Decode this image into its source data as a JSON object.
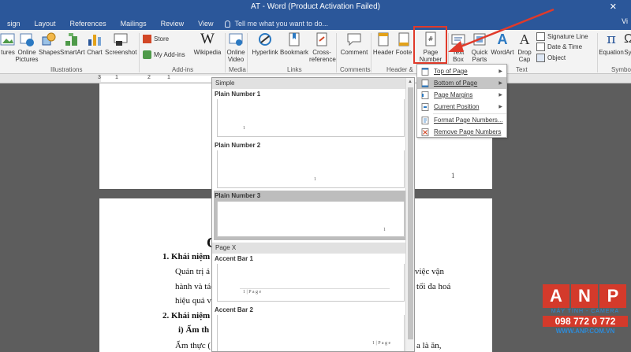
{
  "window": {
    "title": "AT - Word (Product Activation Failed)",
    "close_glyph": "✕"
  },
  "tabs": [
    "sign",
    "Layout",
    "References",
    "Mailings",
    "Review",
    "View"
  ],
  "tell_me": "Tell me what you want to do...",
  "tab_right": "Vi",
  "ribbon": {
    "buttons": {
      "pictures": "tures",
      "online_pictures": "Online Pictures",
      "shapes": "Shapes",
      "smartart": "SmartArt",
      "chart": "Chart",
      "screenshot": "Screenshot",
      "store": "Store",
      "my_addins": "My Add-ins",
      "wikipedia": "Wikipedia",
      "online_video": "Online Video",
      "hyperlink": "Hyperlink",
      "bookmark": "Bookmark",
      "cross_reference": "Cross-reference",
      "comment": "Comment",
      "header": "Header",
      "footer": "Foote",
      "page_number": "Page Number",
      "text_box": "Text Box",
      "quick_parts": "Quick Parts",
      "wordart": "WordArt",
      "drop_cap": "Drop Cap",
      "signature_line": "Signature Line",
      "date_time": "Date & Time",
      "object": "Object",
      "equation": "Equation",
      "symbol": "Sy"
    },
    "groups": {
      "illustrations": "Illustrations",
      "addins": "Add-ins",
      "media": "Media",
      "links": "Links",
      "comments": "Comments",
      "header_footer": "Header &",
      "text": "Text",
      "symbols": "Symbo"
    }
  },
  "ruler": {
    "marks": [
      "3",
      "1",
      "2",
      "1"
    ]
  },
  "gallery": {
    "sections": [
      "Simple",
      "Page X"
    ],
    "items": [
      "Plain Number 1",
      "Plain Number 2",
      "Plain Number 3",
      "Accent Bar 1",
      "Accent Bar 2"
    ],
    "preview_numbers": {
      "n1": "1",
      "n2": "1",
      "n3": "1",
      "accent": "1 | P a g e"
    },
    "selected_item": "Plain Number 3"
  },
  "menu": {
    "items": [
      "Top of Page",
      "Bottom of Page",
      "Page Margins",
      "Current Position",
      "Format Page Numbers...",
      "Remove Page Numbers"
    ],
    "active_item": "Bottom of Page"
  },
  "document": {
    "page1_number": "1",
    "big_letter": "C",
    "line1": "1.  Khái niệm",
    "line2": "Quản trị ả",
    "line2_right": "việc vận",
    "line3": "hành và tác",
    "line3_right": "tối đa hoá",
    "line4": "hiệu quả và",
    "line5": "2.  Khái niệm",
    "line6": "i)   Ẩm th",
    "line7": "Ẩm thực (",
    "line7_right": "a là ăn,"
  },
  "watermark": {
    "letters": [
      "A",
      "N",
      "P"
    ],
    "tagline": "MÁY TÍNH - CAMERA",
    "phone": "098 772 0 772",
    "site": "WWW.ANP.COM.VN"
  },
  "colors": {
    "word_blue": "#2b579a",
    "annotation_red": "#e03a2a",
    "brand_red": "#d43a2b",
    "brand_blue": "#2e8bd8"
  }
}
